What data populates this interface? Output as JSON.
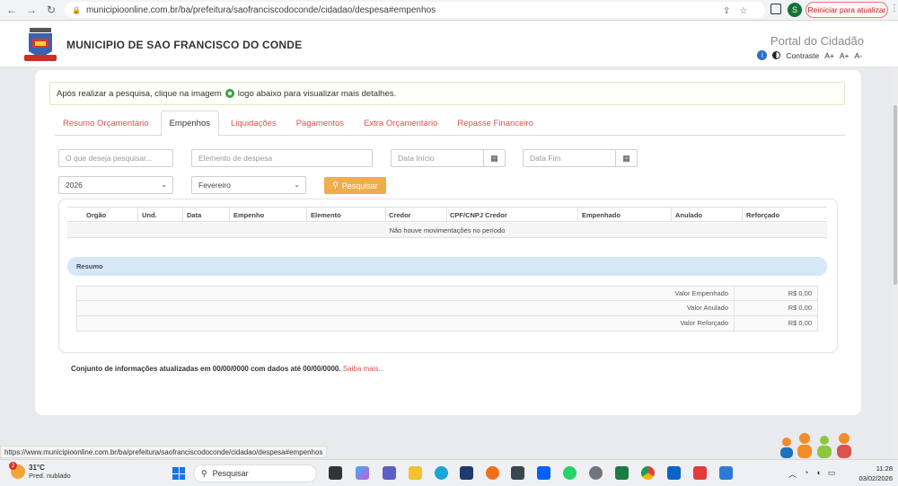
{
  "browser": {
    "url": "municipioonline.com.br/ba/prefeitura/saofranciscodoconde/cidadao/despesa#empenhos",
    "restart_label": "Reiniciar para atualizar",
    "profile_initial": "S",
    "status_url": "https://www.municipioonline.com.br/ba/prefeitura/saofranciscodoconde/cidadao/despesa#empenhos"
  },
  "header": {
    "site_title": "MUNICIPIO DE SAO FRANCISCO DO CONDE",
    "portal_title": "Portal do Cidadão",
    "contrast_label": "Contraste",
    "font_increase": "A+",
    "font_increase2": "A+",
    "font_decrease": "A-"
  },
  "notice": {
    "before": "Após realizar a pesquisa, clique na imagem",
    "after": "logo abaixo para visualizar mais detalhes."
  },
  "tabs": [
    {
      "label": "Resumo Orçamentário",
      "active": false
    },
    {
      "label": "Empenhos",
      "active": true
    },
    {
      "label": "Liquidações",
      "active": false
    },
    {
      "label": "Pagamentos",
      "active": false
    },
    {
      "label": "Extra Orçamentário",
      "active": false
    },
    {
      "label": "Repasse Financeiro",
      "active": false
    }
  ],
  "filters": {
    "search_placeholder": "O que deseja pesquisar...",
    "element_placeholder": "Elemento de despesa",
    "date_start_placeholder": "Data Início",
    "date_end_placeholder": "Data Fim",
    "year_value": "2026",
    "month_value": "Fevereiro",
    "search_button": "Pesquisar"
  },
  "grid": {
    "columns": [
      "Orgão",
      "Und.",
      "Data",
      "Empenho",
      "Elemento",
      "Credor",
      "CPF/CNPJ Credor",
      "Empenhado",
      "Anulado",
      "Reforçado"
    ],
    "empty_message": "Não houve movimentações no período"
  },
  "resumo": {
    "title": "Resumo",
    "rows": [
      {
        "label": "Valor Empenhado",
        "value": "R$ 0,00"
      },
      {
        "label": "Valor Anulado",
        "value": "R$ 0,00"
      },
      {
        "label": "Valor Reforçado",
        "value": "R$ 0,00"
      }
    ]
  },
  "footer": {
    "note": "Conjunto de informações atualizadas em 00/00/0000 com dados até 00/00/0000.",
    "more": "Saiba mais..."
  },
  "taskbar": {
    "weather_temp": "31°C",
    "weather_desc": "Pred. nublado",
    "weather_badge": "2",
    "search_label": "Pesquisar",
    "time": "11:28",
    "date": "03/02/2026"
  },
  "colors": {
    "accent_red": "#d9534f",
    "search_orange": "#f0ad4e",
    "resumo_blue": "#d6e7f5"
  }
}
